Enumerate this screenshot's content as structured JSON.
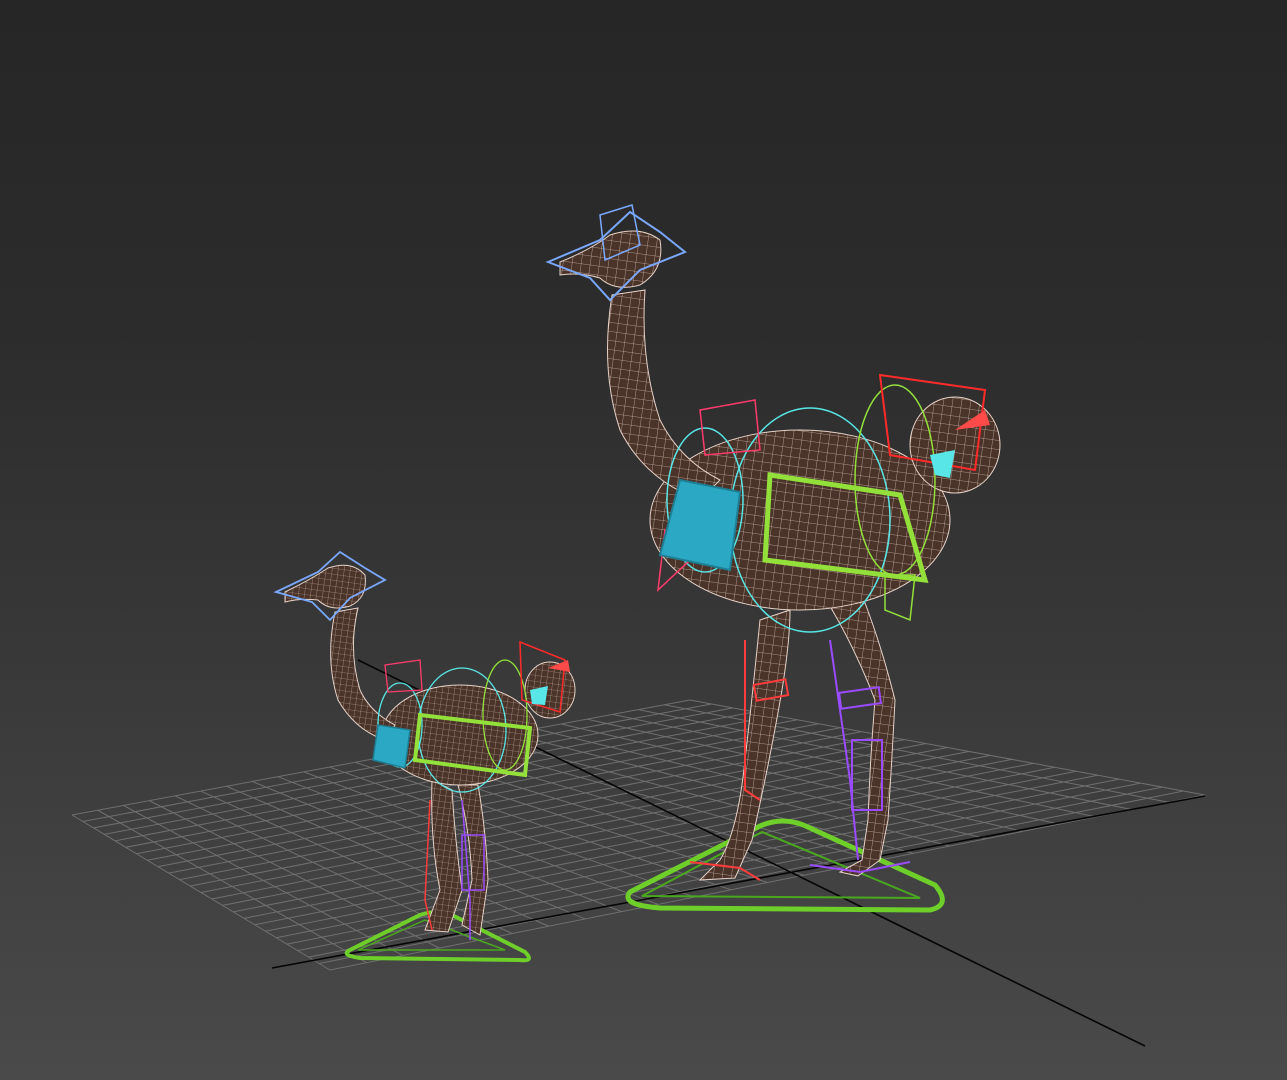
{
  "viewport": {
    "background_top": "#262626",
    "background_bottom": "#4a4a4a",
    "grid_color": "#6f6f6f",
    "axis_color": "#000000"
  },
  "scene": {
    "objects": [
      {
        "name": "ostrich-large",
        "rig": "biped-rig"
      },
      {
        "name": "ostrich-small",
        "rig": "biped-rig"
      }
    ],
    "colors": {
      "mesh_fill": "#4a3328",
      "mesh_wire": "#e6d2c8",
      "head_control": "#7aa8ff",
      "ground_control": "#6ecf2a",
      "pelvis_control": "#2aa8c4",
      "spine_control": "#93e03a",
      "leg_left": "#ff3b3b",
      "leg_right": "#9a4bff",
      "tail_control": "#ff2a2a",
      "circle_control": "#58e6e6"
    }
  }
}
